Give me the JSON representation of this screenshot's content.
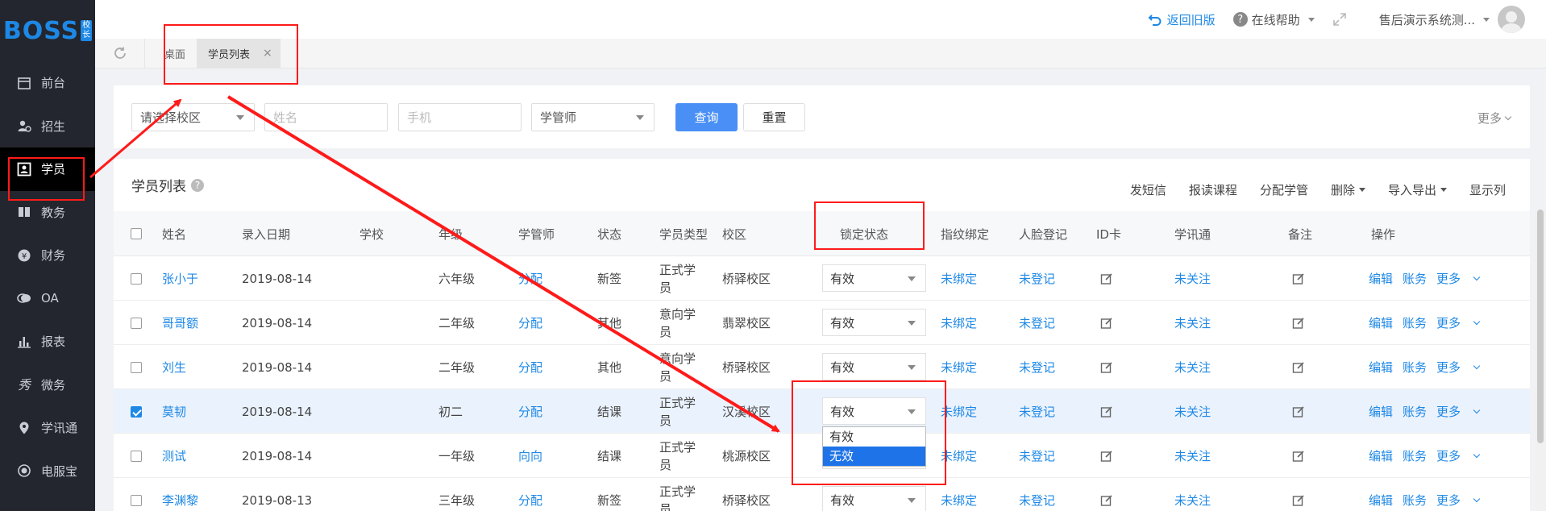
{
  "sidebar": {
    "logo": "BOSS",
    "logo_badge": "校长",
    "items": [
      {
        "label": "前台",
        "icon": "calendar-icon"
      },
      {
        "label": "招生",
        "icon": "person-add-icon"
      },
      {
        "label": "学员",
        "icon": "id-card-icon"
      },
      {
        "label": "教务",
        "icon": "book-icon"
      },
      {
        "label": "财务",
        "icon": "yen-icon"
      },
      {
        "label": "OA",
        "icon": "chat-icon"
      },
      {
        "label": "报表",
        "icon": "bar-chart-icon"
      },
      {
        "label": "微务",
        "icon": "wechat-icon"
      },
      {
        "label": "学讯通",
        "icon": "location-icon"
      },
      {
        "label": "电服宝",
        "icon": "phone-icon"
      }
    ],
    "active_index": 2
  },
  "header": {
    "back_old": "返回旧版",
    "online_help": "在线帮助",
    "user_name": "售后演示系统测..."
  },
  "tabs": {
    "desk": "桌面",
    "current": "学员列表",
    "close": "×"
  },
  "filters": {
    "campus_placeholder": "请选择校区",
    "name_placeholder": "姓名",
    "phone_placeholder": "手机",
    "manager": "学管师",
    "query": "查询",
    "reset": "重置",
    "more": "更多"
  },
  "list": {
    "title": "学员列表",
    "help": "?",
    "toolbar": {
      "sms": "发短信",
      "enroll": "报读课程",
      "assign": "分配学管",
      "delete": "删除",
      "import_export": "导入导出",
      "columns": "显示列"
    },
    "columns": [
      "姓名",
      "录入日期",
      "学校",
      "年级",
      "学管师",
      "状态",
      "学员类型",
      "校区",
      "锁定状态",
      "指纹绑定",
      "人脸登记",
      "ID卡",
      "学讯通",
      "备注",
      "操作"
    ],
    "ops": {
      "edit": "编辑",
      "account": "账务",
      "more": "更多"
    },
    "rows": [
      {
        "name": "张小于",
        "date": "2019-08-14",
        "school": "",
        "grade": "六年级",
        "manager": "分配",
        "status": "新签",
        "type": "正式学员",
        "campus": "桥驿校区",
        "lock": "有效",
        "finger": "未绑定",
        "face": "未登记",
        "wechat": "未关注",
        "checked": false
      },
      {
        "name": "哥哥额",
        "date": "2019-08-14",
        "school": "",
        "grade": "二年级",
        "manager": "分配",
        "status": "其他",
        "type": "意向学员",
        "campus": "翡翠校区",
        "lock": "有效",
        "finger": "未绑定",
        "face": "未登记",
        "wechat": "未关注",
        "checked": false
      },
      {
        "name": "刘生",
        "date": "2019-08-14",
        "school": "",
        "grade": "二年级",
        "manager": "分配",
        "status": "其他",
        "type": "意向学员",
        "campus": "桥驿校区",
        "lock": "有效",
        "finger": "未绑定",
        "face": "未登记",
        "wechat": "未关注",
        "checked": false
      },
      {
        "name": "莫韧",
        "date": "2019-08-14",
        "school": "",
        "grade": "初二",
        "manager": "分配",
        "status": "结课",
        "type": "正式学员",
        "campus": "汉溪校区",
        "lock": "有效",
        "finger": "未绑定",
        "face": "未登记",
        "wechat": "未关注",
        "checked": true
      },
      {
        "name": "测试",
        "date": "2019-08-14",
        "school": "",
        "grade": "一年级",
        "manager": "向向",
        "status": "结课",
        "type": "正式学员",
        "campus": "桃源校区",
        "lock": "有效",
        "finger": "未绑定",
        "face": "未登记",
        "wechat": "未关注",
        "checked": false
      },
      {
        "name": "李渊黎",
        "date": "2019-08-13",
        "school": "",
        "grade": "三年级",
        "manager": "分配",
        "status": "新签",
        "type": "正式学员",
        "campus": "桥驿校区",
        "lock": "有效",
        "finger": "未绑定",
        "face": "未登记",
        "wechat": "未关注",
        "checked": false
      }
    ]
  },
  "dropdown": {
    "options": [
      "有效",
      "无效"
    ],
    "highlighted": 1
  },
  "annotation_color": "#ff1a1a"
}
